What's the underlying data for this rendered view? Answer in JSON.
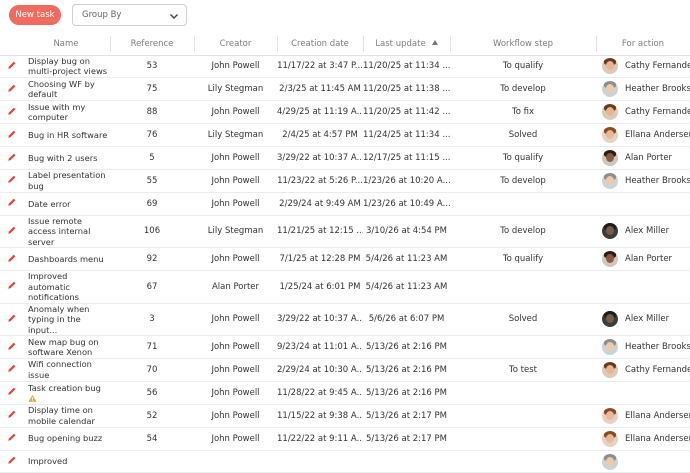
{
  "toolbar": {
    "new_task_label": "New task",
    "group_by_label": "Group By"
  },
  "columns": {
    "name": "Name",
    "reference": "Reference",
    "creator": "Creator",
    "creation_date": "Creation date",
    "last_update": "Last update",
    "workflow_step": "Workflow step",
    "for_action": "For action"
  },
  "sort": {
    "column": "Last update",
    "direction": "ascending"
  },
  "rows": [
    {
      "name": "Display bug on multi-project views",
      "reference": "53",
      "creator": "John Powell",
      "creation_date": "11/17/22 at 3:47 P...",
      "last_update": "11/20/25 at 11:34 ...",
      "workflow_step": "To qualify",
      "for_action": "Cathy Fernandez",
      "avatar": "cathy"
    },
    {
      "name": "Choosing WF by default",
      "reference": "75",
      "creator": "Lily Stegman",
      "creation_date": "2/3/25 at 11:45 AM",
      "last_update": "11/20/25 at 11:38 ...",
      "workflow_step": "To develop",
      "for_action": "Heather Brooks",
      "avatar": "heather"
    },
    {
      "name": "Issue with my computer",
      "reference": "88",
      "creator": "John Powell",
      "creation_date": "4/29/25 at 11:19 A...",
      "last_update": "11/20/25 at 11:42 ...",
      "workflow_step": "To fix",
      "for_action": "Cathy Fernandez",
      "avatar": "cathy"
    },
    {
      "name": "Bug in HR software",
      "reference": "76",
      "creator": "Lily Stegman",
      "creation_date": "2/4/25 at 4:57 PM",
      "last_update": "11/24/25 at 11:34 ...",
      "workflow_step": "Solved",
      "for_action": "Ellana Andersen",
      "avatar": "ellana"
    },
    {
      "name": "Bug with 2 users",
      "reference": "5",
      "creator": "John Powell",
      "creation_date": "3/29/22 at 10:37 A...",
      "last_update": "12/17/25 at 11:15 ...",
      "workflow_step": "To qualify",
      "for_action": "Alan Porter",
      "avatar": "alan"
    },
    {
      "name": "Label presentation bug",
      "reference": "55",
      "creator": "John Powell",
      "creation_date": "11/23/22 at 5:26 P...",
      "last_update": "1/23/26 at 10:20 A...",
      "workflow_step": "To develop",
      "for_action": "Heather Brooks",
      "avatar": "heather"
    },
    {
      "name": "Date error",
      "reference": "69",
      "creator": "John Powell",
      "creation_date": "2/29/24 at 9:49 AM",
      "last_update": "1/23/26 at 10:49 A...",
      "workflow_step": "",
      "for_action": "",
      "avatar": ""
    },
    {
      "name": "Issue remote access internal server",
      "reference": "106",
      "creator": "Lily Stegman",
      "creation_date": "11/21/25 at 12:15 ...",
      "last_update": "3/10/26 at 4:54 PM",
      "workflow_step": "To develop",
      "for_action": "Alex Miller",
      "avatar": "alex"
    },
    {
      "name": "Dashboards menu",
      "reference": "92",
      "creator": "John Powell",
      "creation_date": "7/1/25 at 12:28 PM",
      "last_update": "5/4/26 at 11:23 AM",
      "workflow_step": "To qualify",
      "for_action": "Alan Porter",
      "avatar": "alan"
    },
    {
      "name": "Improved automatic notifications",
      "reference": "67",
      "creator": "Alan Porter",
      "creation_date": "1/25/24 at 6:01 PM",
      "last_update": "5/4/26 at 11:23 AM",
      "workflow_step": "",
      "for_action": "",
      "avatar": ""
    },
    {
      "name": "Anomaly when typing in the input...",
      "reference": "3",
      "creator": "John Powell",
      "creation_date": "3/29/22 at 10:37 A...",
      "last_update": "5/6/26 at 6:07 PM",
      "workflow_step": "Solved",
      "for_action": "Alex Miller",
      "avatar": "alex"
    },
    {
      "name": "New map bug on software Xenon",
      "reference": "71",
      "creator": "John Powell",
      "creation_date": "9/23/24 at 11:01 A...",
      "last_update": "5/13/26 at 2:16 PM",
      "workflow_step": "",
      "for_action": "Heather Brooks",
      "avatar": "heather"
    },
    {
      "name": "Wifi connection issue",
      "reference": "70",
      "creator": "John Powell",
      "creation_date": "2/29/24 at 10:30 A...",
      "last_update": "5/13/26 at 2:16 PM",
      "workflow_step": "To test",
      "for_action": "Cathy Fernandez",
      "avatar": "cathy"
    },
    {
      "name": "Task creation bug",
      "reference": "56",
      "creator": "John Powell",
      "creation_date": "11/28/22 at 9:45 A...",
      "last_update": "5/13/26 at 2:16 PM",
      "workflow_step": "",
      "for_action": "",
      "avatar": "",
      "warning": true
    },
    {
      "name": "Display time on mobile calendar",
      "reference": "52",
      "creator": "John Powell",
      "creation_date": "11/15/22 at 9:38 A...",
      "last_update": "5/13/26 at 2:17 PM",
      "workflow_step": "",
      "for_action": "Ellana Andersen",
      "avatar": "ellana"
    },
    {
      "name": "Bug opening buzz",
      "reference": "54",
      "creator": "John Powell",
      "creation_date": "11/22/22 at 9:11 A...",
      "last_update": "5/13/26 at 2:17 PM",
      "workflow_step": "",
      "for_action": "Ellana Andersen",
      "avatar": "ellana"
    },
    {
      "name": "Improved",
      "reference": "",
      "creator": "",
      "creation_date": "",
      "last_update": "",
      "workflow_step": "",
      "for_action": "",
      "avatar": "heather"
    }
  ],
  "colors": {
    "accent": "#ef6a5f",
    "edit_icon": "#e0483d",
    "warning_icon": "#f0a13a"
  },
  "avatars": {
    "cathy": {
      "skin": "#e8b58f",
      "hair": "#6b3a1f",
      "bg": "#d9cbb8"
    },
    "heather": {
      "skin": "#f0c9a6",
      "hair": "#8e8e8e",
      "bg": "#c9d3d8"
    },
    "ellana": {
      "skin": "#e9b896",
      "hair": "#8a4a24",
      "bg": "#e6d2c2"
    },
    "alan": {
      "skin": "#8b5a3c",
      "hair": "#2b1c14",
      "bg": "#cfc6bf"
    },
    "alex": {
      "skin": "#7a5a48",
      "hair": "#1e1e1e",
      "bg": "#3c3c3c"
    }
  },
  "icons": {
    "edit": "pencil-icon",
    "group_by_chevron": "chevron-down-icon",
    "sort": "sort-ascending-icon",
    "warning": "warning-icon"
  }
}
